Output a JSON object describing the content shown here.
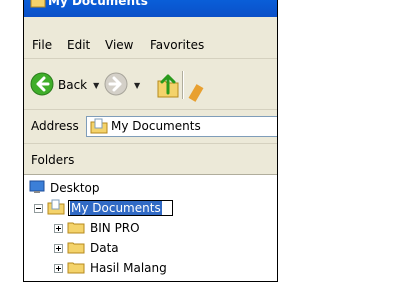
{
  "window": {
    "title": "My Documents"
  },
  "menu": {
    "items": [
      "File",
      "Edit",
      "View",
      "Favorites"
    ]
  },
  "toolbar": {
    "back_label": "Back"
  },
  "address": {
    "label": "Address",
    "value": "My Documents"
  },
  "folders_pane": {
    "header": "Folders",
    "tree": [
      {
        "label": "Desktop",
        "icon": "desktop-icon"
      },
      {
        "label": "My Documents",
        "icon": "my-documents-icon",
        "expander": "minus",
        "editing": true
      },
      {
        "label": "BIN PRO",
        "icon": "folder-icon",
        "expander": "plus"
      },
      {
        "label": "Data",
        "icon": "folder-icon",
        "expander": "plus"
      },
      {
        "label": "Hasil Malang",
        "icon": "folder-icon",
        "expander": "plus"
      }
    ]
  },
  "colors": {
    "titlebar": "#0b56d0",
    "chrome": "#ece9d8",
    "selection": "#316ac5",
    "back_arrow": "#3fae2a"
  }
}
